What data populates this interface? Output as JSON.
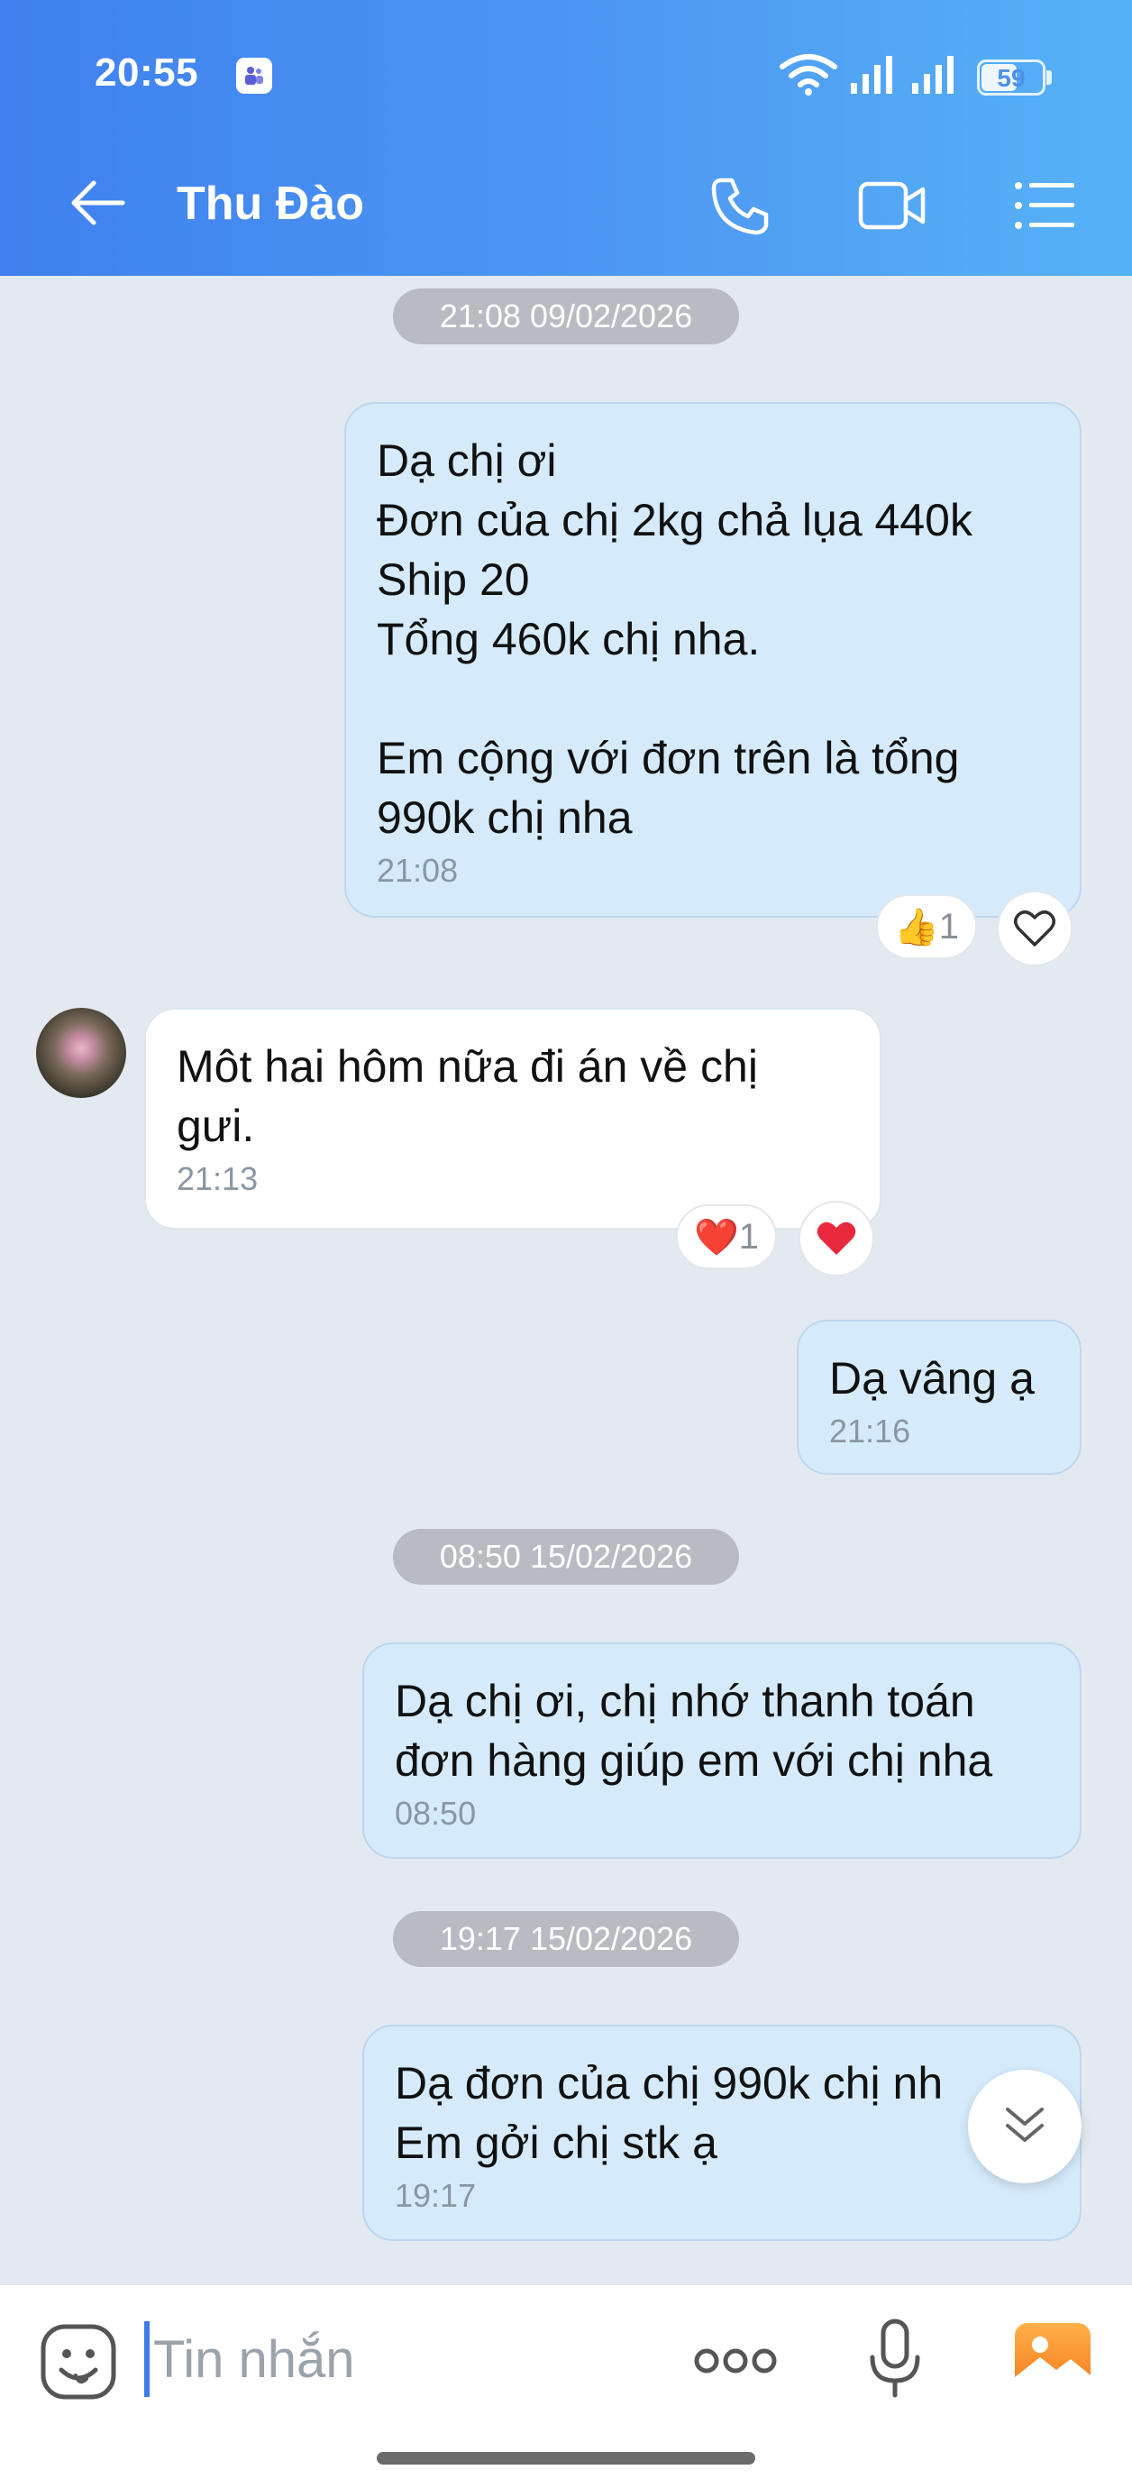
{
  "status_bar": {
    "time": "20:55",
    "battery": "59"
  },
  "header": {
    "contact_name": "Thu Đào",
    "colors": {
      "gradient_start": "#3f80ee",
      "gradient_end": "#56b2f6"
    },
    "icons": [
      "back-arrow-icon",
      "phone-icon",
      "video-camera-icon",
      "list-menu-icon"
    ]
  },
  "chat": {
    "date_separators": [
      "21:08 09/02/2026",
      "08:50 15/02/2026",
      "19:17 15/02/2026"
    ],
    "messages": [
      {
        "direction": "outgoing",
        "text": "Dạ chị ơi\nĐơn của chị 2kg chả lụa 440k\nShip 20\nTổng 460k chị nha.\n\nEm cộng với đơn trên là tổng\n990k chị nha",
        "time": "21:08",
        "reaction": {
          "emoji": "👍",
          "count": "1"
        }
      },
      {
        "direction": "incoming",
        "text": "Môt hai hôm nữa đi án về chị\ngưi.",
        "time": "21:13",
        "reaction": {
          "emoji": "❤️",
          "count": "1"
        }
      },
      {
        "direction": "outgoing",
        "text": "Dạ vâng ạ",
        "time": "21:16"
      },
      {
        "direction": "outgoing",
        "text": "Dạ chị ơi, chị nhớ thanh toán\nđơn hàng giúp em với chị nha",
        "time": "08:50"
      },
      {
        "direction": "outgoing",
        "text": "Dạ đơn của chị 990k chị nh\nEm gởi chị stk ạ",
        "time": "19:17"
      }
    ],
    "colors": {
      "outgoing_bubble": "#d5ebfc",
      "incoming_bubble": "#ffffff",
      "background": "#e2e9f1"
    }
  },
  "input": {
    "placeholder": "Tin nhắn",
    "icons": [
      "emoji-sticker-icon",
      "more-options-icon",
      "microphone-icon",
      "image-gallery-icon"
    ]
  }
}
